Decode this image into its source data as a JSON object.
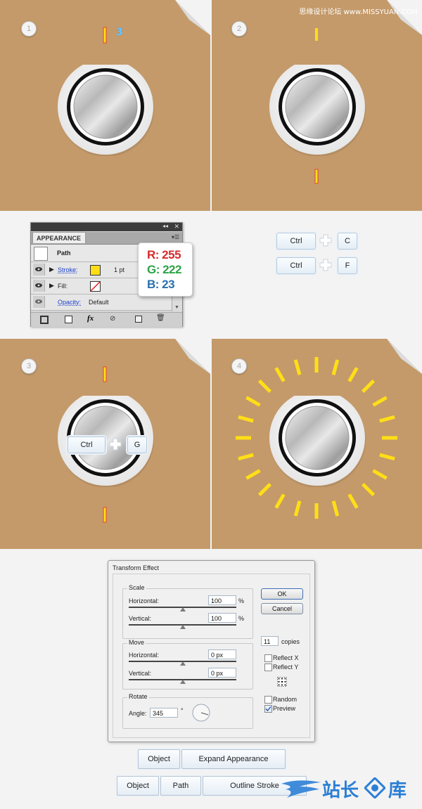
{
  "watermark_top": "思缘设计论坛 www.MISSYUAN.COM",
  "steps": [
    "1",
    "2",
    "3",
    "4"
  ],
  "step1_annotation": "3",
  "appearance_panel": {
    "tab": "APPEARANCE",
    "header": "Path",
    "stroke_label": "Stroke:",
    "stroke_value": "1 pt",
    "stroke_color": "#FFDE17",
    "fill_label": "Fill:",
    "opacity_label": "Opacity:",
    "opacity_value": "Default",
    "bottom_fx": "fx"
  },
  "rgb_tooltip": {
    "r": "R: 255",
    "g": "G: 222",
    "b": "B: 23"
  },
  "shortcuts": {
    "copy_key1": "Ctrl",
    "copy_key2": "C",
    "paste_key1": "Ctrl",
    "paste_key2": "F",
    "group_key1": "Ctrl",
    "group_key2": "G"
  },
  "transform_dialog": {
    "title": "Transform Effect",
    "scale_group": "Scale",
    "scale_h_label": "Horizontal:",
    "scale_h_value": "100",
    "scale_h_unit": "%",
    "scale_v_label": "Vertical:",
    "scale_v_value": "100",
    "scale_v_unit": "%",
    "move_group": "Move",
    "move_h_label": "Horizontal:",
    "move_h_value": "0 px",
    "move_v_label": "Vertical:",
    "move_v_value": "0 px",
    "rotate_group": "Rotate",
    "angle_label": "Angle:",
    "angle_value": "345",
    "angle_unit": "°",
    "ok": "OK",
    "cancel": "Cancel",
    "copies_value": "11",
    "copies_label": "copies",
    "reflect_x": "Reflect X",
    "reflect_y": "Reflect Y",
    "random": "Random",
    "preview": "Preview",
    "preview_checked": true
  },
  "menu_path1": [
    "Object",
    "Expand Appearance"
  ],
  "menu_path2": [
    "Object",
    "Path",
    "Outline Stroke"
  ],
  "watermark_bottom": "站长",
  "watermark_bottom2": "库",
  "colors": {
    "background": "#C49A6A",
    "tick_yellow": "#FFDE17",
    "tick_red": "#E8412C"
  }
}
